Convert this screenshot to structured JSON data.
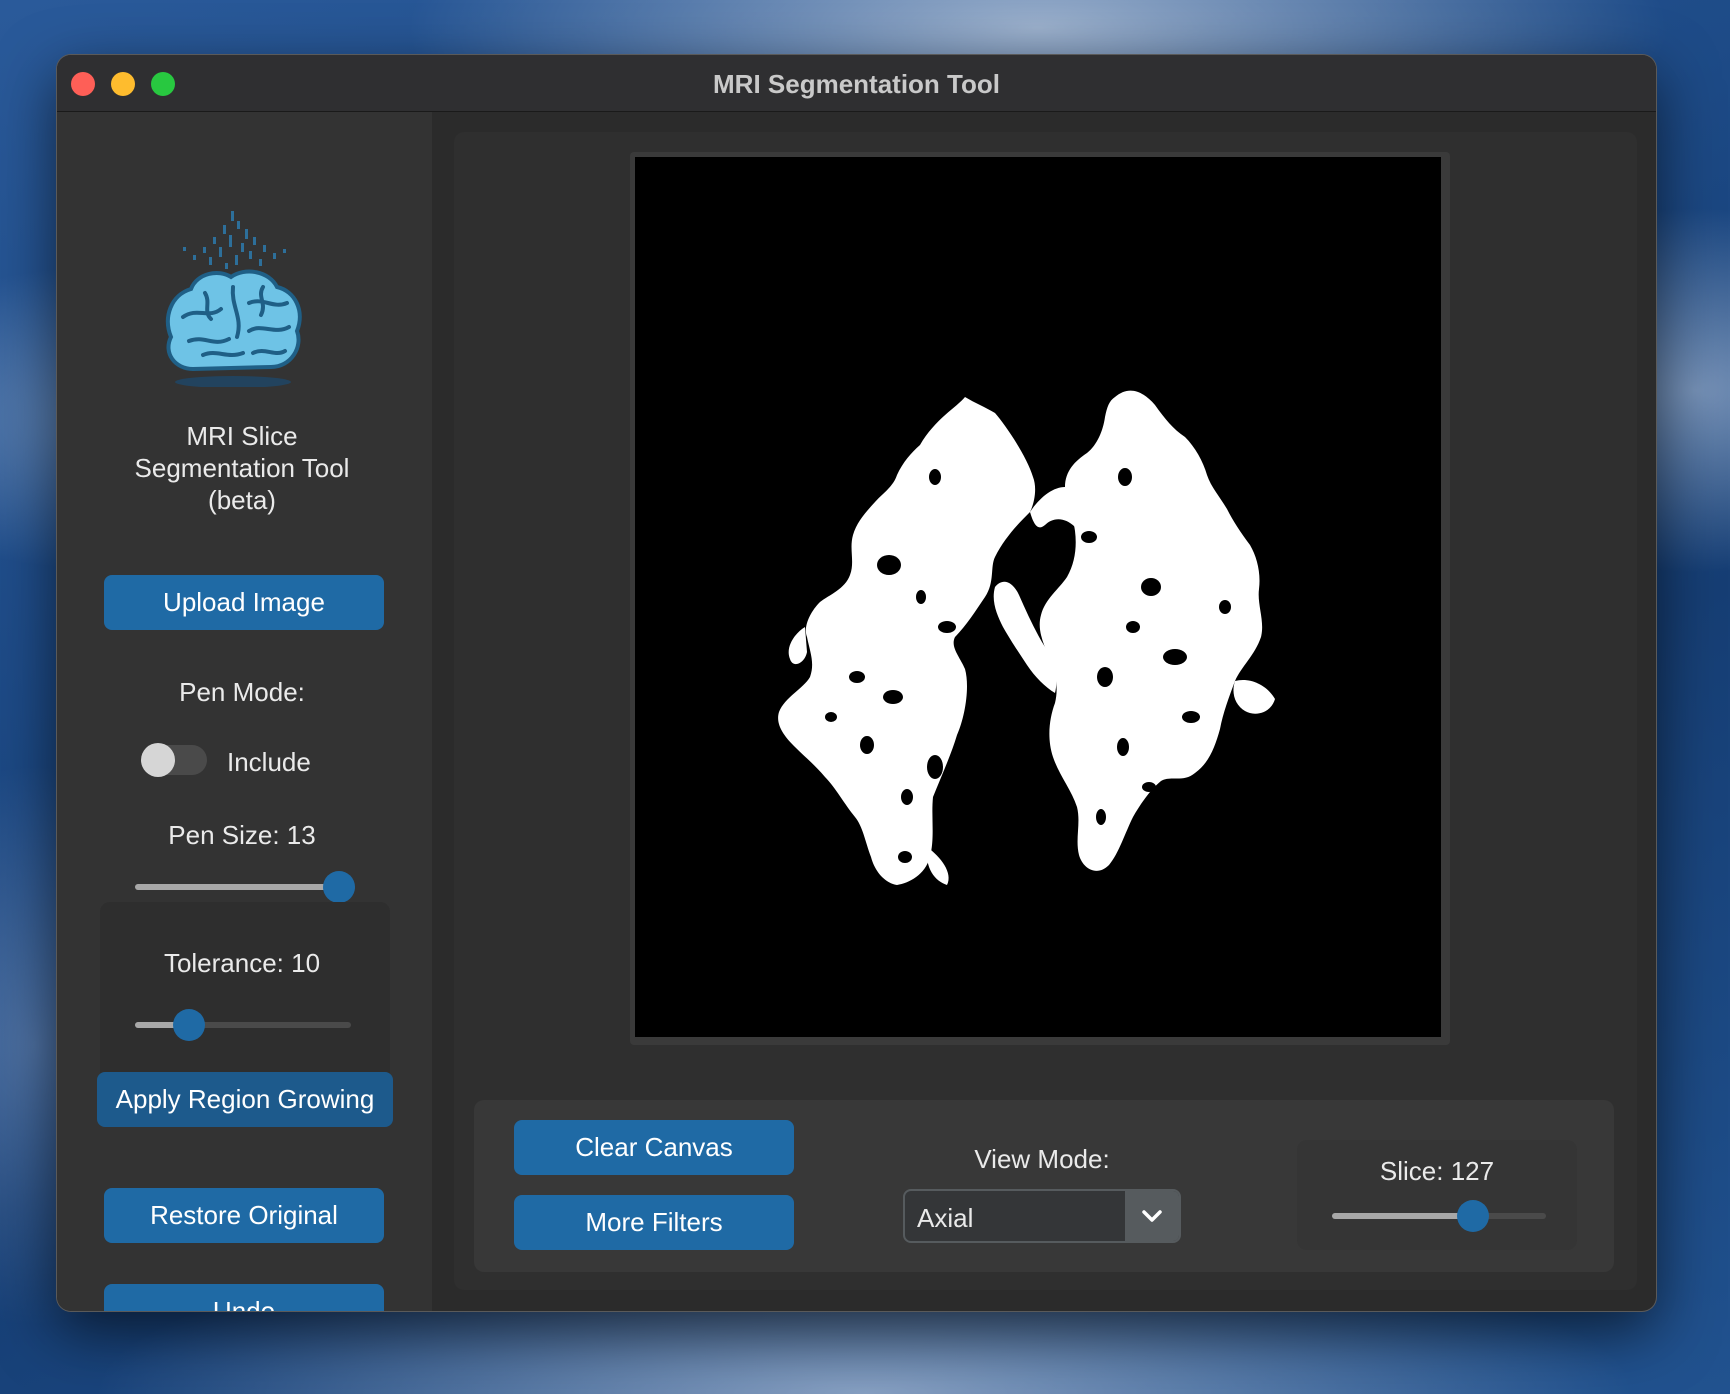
{
  "window": {
    "title": "MRI Segmentation Tool"
  },
  "sidebar": {
    "logo_icon": "brain-icon",
    "app_name_line1": "MRI Slice",
    "app_name_line2": "Segmentation Tool",
    "app_name_line3": "(beta)",
    "upload_label": "Upload Image",
    "pen_mode_label": "Pen Mode:",
    "pen_mode_switch": {
      "state": "off",
      "label": "Include"
    },
    "pen_size_label": "Pen Size: 13",
    "pen_size_value": 13,
    "pen_size_fraction": 0.96,
    "tolerance_label": "Tolerance: 10",
    "tolerance_value": 10,
    "tolerance_fraction": 0.25,
    "apply_label": "Apply Region Growing",
    "restore_label": "Restore Original",
    "undo_label": "Undo"
  },
  "controls": {
    "clear_label": "Clear Canvas",
    "filters_label": "More Filters",
    "view_mode_label": "View Mode:",
    "view_mode_value": "Axial",
    "slice_label": "Slice: 127",
    "slice_value": 127,
    "slice_fraction": 0.66
  },
  "colors": {
    "accent": "#1f6aa5",
    "window_bg": "#2b2b2b",
    "sidebar_bg": "#333333",
    "canvas_bg": "#000000",
    "segmentation": "#ffffff"
  }
}
